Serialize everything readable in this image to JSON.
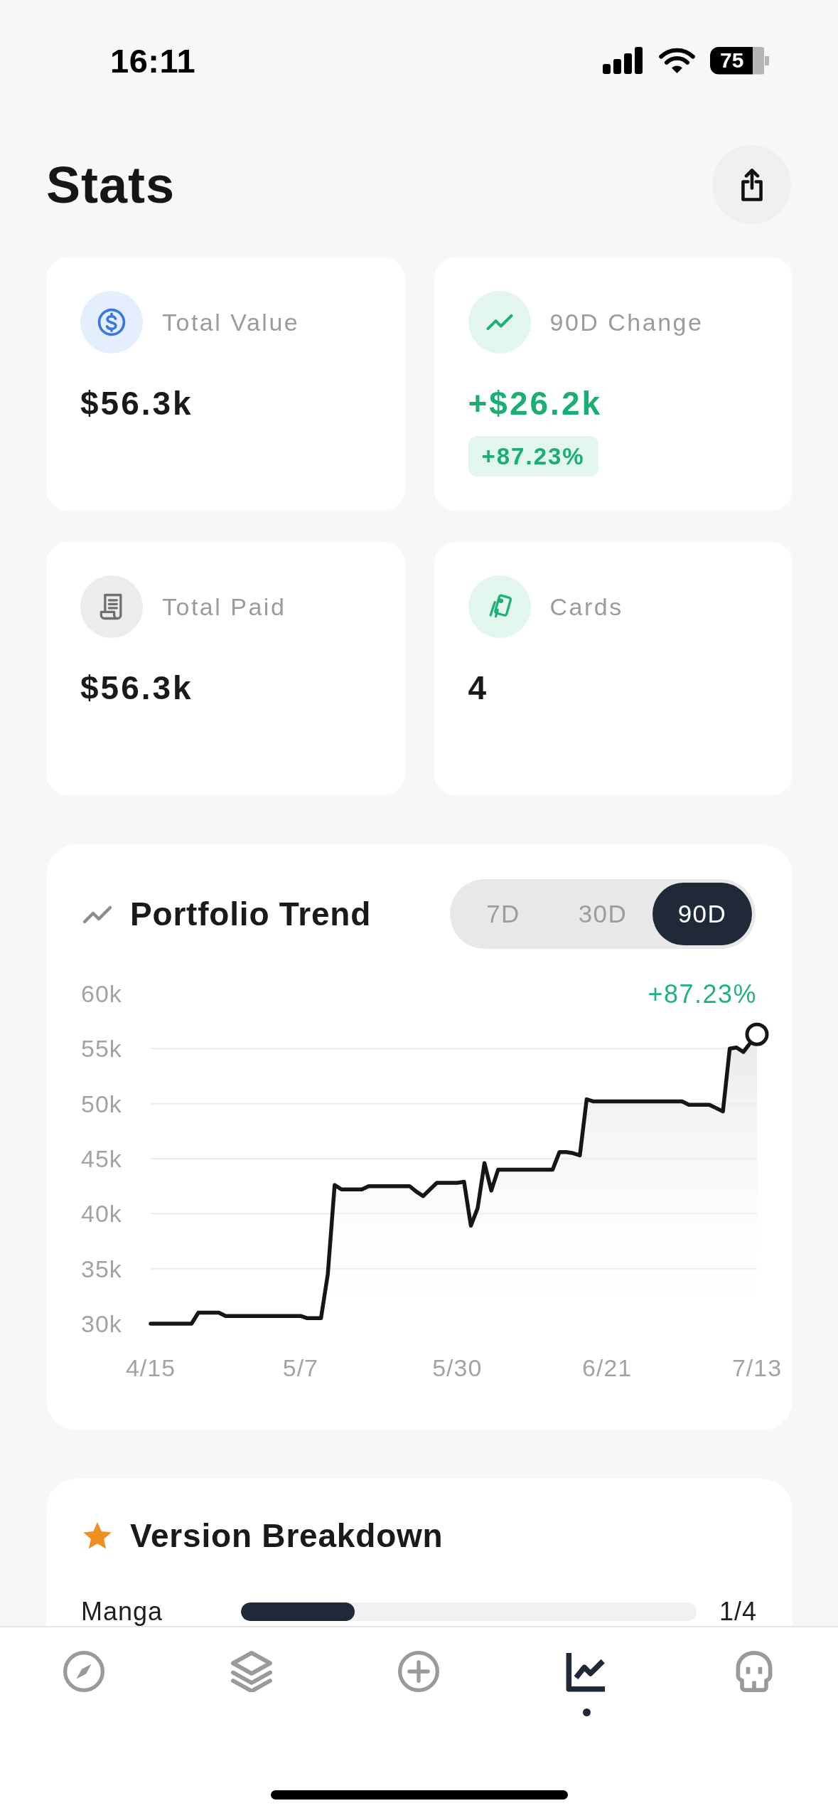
{
  "status_bar": {
    "time": "16:11",
    "battery": "75"
  },
  "header": {
    "title": "Stats"
  },
  "stat_cards": [
    {
      "kind": "value",
      "label": "Total Value",
      "value": "$56.3k"
    },
    {
      "kind": "change",
      "label": "90D Change",
      "value": "+$26.2k",
      "badge": "+87.23%"
    },
    {
      "kind": "paid",
      "label": "Total Paid",
      "value": "$56.3k"
    },
    {
      "kind": "count",
      "label": "Cards",
      "value": "4"
    }
  ],
  "portfolio_trend": {
    "title": "Portfolio Trend",
    "ranges": [
      {
        "label": "7D",
        "selected": false
      },
      {
        "label": "30D",
        "selected": false
      },
      {
        "label": "90D",
        "selected": true
      }
    ],
    "change_label": "+87.23%",
    "chart_data": {
      "type": "area",
      "grid": true,
      "categories": [
        "4/15",
        null,
        null,
        null,
        null,
        null,
        null,
        null,
        null,
        null,
        null,
        null,
        null,
        null,
        null,
        null,
        null,
        null,
        null,
        null,
        null,
        null,
        "5/7",
        null,
        null,
        null,
        null,
        null,
        null,
        null,
        null,
        null,
        null,
        null,
        null,
        null,
        null,
        null,
        null,
        null,
        null,
        null,
        null,
        null,
        null,
        "5/30",
        null,
        null,
        null,
        null,
        null,
        null,
        null,
        null,
        null,
        null,
        null,
        null,
        null,
        null,
        null,
        null,
        null,
        null,
        null,
        null,
        null,
        "6/21",
        null,
        null,
        null,
        null,
        null,
        null,
        null,
        null,
        null,
        null,
        null,
        null,
        null,
        null,
        null,
        null,
        null,
        null,
        null,
        null,
        null,
        "7/13"
      ],
      "values": [
        30.0,
        30.0,
        30.0,
        30.0,
        30.0,
        30.0,
        30.0,
        31.0,
        31.0,
        31.0,
        31.0,
        30.7,
        30.7,
        30.7,
        30.7,
        30.7,
        30.7,
        30.7,
        30.7,
        30.7,
        30.7,
        30.7,
        30.7,
        30.5,
        30.5,
        30.5,
        34.5,
        42.6,
        42.2,
        42.2,
        42.2,
        42.2,
        42.5,
        42.5,
        42.5,
        42.5,
        42.5,
        42.5,
        42.5,
        42.0,
        41.6,
        42.2,
        42.8,
        42.8,
        42.8,
        42.8,
        42.9,
        38.9,
        40.5,
        44.6,
        42.1,
        44.0,
        44.0,
        44.0,
        44.0,
        44.0,
        44.0,
        44.0,
        44.0,
        44.0,
        45.6,
        45.6,
        45.5,
        45.3,
        50.4,
        50.2,
        50.2,
        50.2,
        50.2,
        50.2,
        50.2,
        50.2,
        50.2,
        50.2,
        50.2,
        50.2,
        50.2,
        50.2,
        50.2,
        49.9,
        49.9,
        49.9,
        49.9,
        49.6,
        49.3,
        55.0,
        55.1,
        54.7,
        55.5,
        56.3
      ],
      "ylim": [
        30,
        60
      ],
      "yticks": [
        {
          "value": 30,
          "label": "30k"
        },
        {
          "value": 35,
          "label": "35k"
        },
        {
          "value": 40,
          "label": "40k"
        },
        {
          "value": 45,
          "label": "45k"
        },
        {
          "value": 50,
          "label": "50k"
        },
        {
          "value": 55,
          "label": "55k"
        },
        {
          "value": 60,
          "label": "60k"
        }
      ]
    }
  },
  "version_breakdown": {
    "title": "Version Breakdown",
    "rows": [
      {
        "label": "Manga",
        "level": 0.25,
        "count": "1/4"
      }
    ]
  },
  "tab_bar": {
    "tabs": [
      {
        "kind": "compass",
        "selected": false
      },
      {
        "kind": "layers",
        "selected": false
      },
      {
        "kind": "plus",
        "selected": false
      },
      {
        "kind": "chart",
        "selected": true
      },
      {
        "kind": "skull",
        "selected": false
      }
    ]
  }
}
